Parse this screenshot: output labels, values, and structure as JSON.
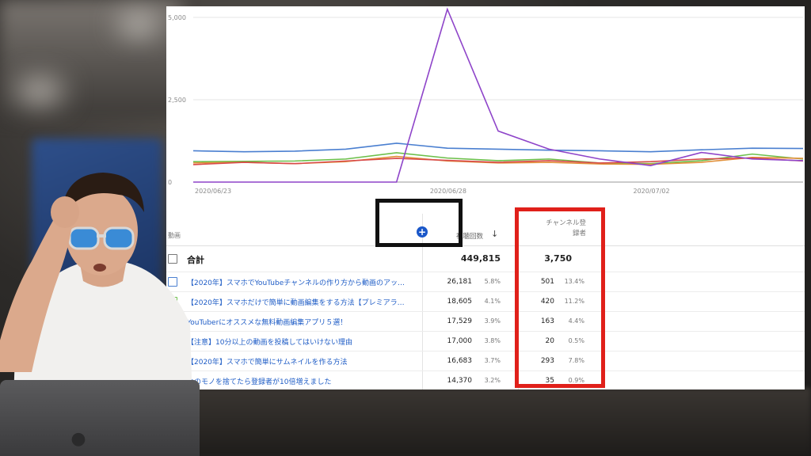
{
  "chart_data": {
    "type": "line",
    "x": [
      "2020/06/23",
      "2020/06/24",
      "2020/06/25",
      "2020/06/26",
      "2020/06/27",
      "2020/06/28",
      "2020/06/29",
      "2020/06/30",
      "2020/07/01",
      "2020/07/02",
      "2020/07/03",
      "2020/07/04",
      "2020/07/05"
    ],
    "x_tick_labels": [
      "2020/06/23",
      "2020/06/28",
      "2020/07/02"
    ],
    "y_tick_labels": [
      "0",
      "2,500",
      "5,000"
    ],
    "ylim": [
      0,
      5000
    ],
    "series": [
      {
        "color": "#8e44c9",
        "values": [
          0,
          0,
          0,
          0,
          0,
          6200,
          1550,
          1000,
          700,
          500,
          900,
          700,
          650
        ]
      },
      {
        "color": "#4a7fd0",
        "values": [
          950,
          920,
          940,
          1000,
          1180,
          1030,
          1000,
          970,
          950,
          920,
          980,
          1030,
          1020
        ]
      },
      {
        "color": "#6cbf4a",
        "values": [
          620,
          630,
          640,
          700,
          890,
          730,
          650,
          700,
          580,
          560,
          650,
          850,
          700
        ]
      },
      {
        "color": "#e2903a",
        "values": [
          580,
          600,
          560,
          620,
          780,
          640,
          580,
          600,
          550,
          540,
          600,
          750,
          720
        ]
      },
      {
        "color": "#d84a4a",
        "values": [
          530,
          600,
          560,
          640,
          720,
          660,
          600,
          650,
          580,
          620,
          700,
          730,
          640
        ]
      }
    ]
  },
  "table": {
    "header": {
      "video": "動画",
      "views": "視聴回数",
      "sort_arrow": "↓",
      "subscribers_line1": "チャンネル登",
      "subscribers_line2": "録者"
    },
    "total": {
      "label": "合計",
      "views": "449,815",
      "subscribers": "3,750"
    },
    "rows": [
      {
        "title": "【2020年】スマホでYouTubeチャンネルの作り方から動画のアッ…",
        "views": "26,181",
        "views_pct": "5.8%",
        "subs": "501",
        "subs_pct": "13.4%",
        "color": "#4a7fd0"
      },
      {
        "title": "【2020年】スマホだけで簡単に動画編集をする方法【プレミアラ…",
        "views": "18,605",
        "views_pct": "4.1%",
        "subs": "420",
        "subs_pct": "11.2%",
        "color": "#6cbf4a"
      },
      {
        "title": "YouTuberにオススメな無料動画編集アプリ５選！",
        "views": "17,529",
        "views_pct": "3.9%",
        "subs": "163",
        "subs_pct": "4.4%",
        "color": ""
      },
      {
        "title": "【注意】10分以上の動画を投稿してはいけない理由",
        "views": "17,000",
        "views_pct": "3.8%",
        "subs": "20",
        "subs_pct": "0.5%",
        "color": ""
      },
      {
        "title": "【2020年】スマホで簡単にサムネイルを作る方法",
        "views": "16,683",
        "views_pct": "3.7%",
        "subs": "293",
        "subs_pct": "7.8%",
        "color": ""
      },
      {
        "title": "つのモノを捨てたら登録者が10倍増えました",
        "views": "14,370",
        "views_pct": "3.2%",
        "subs": "35",
        "subs_pct": "0.9%",
        "color": ""
      }
    ]
  },
  "add_button_symbol": "+"
}
